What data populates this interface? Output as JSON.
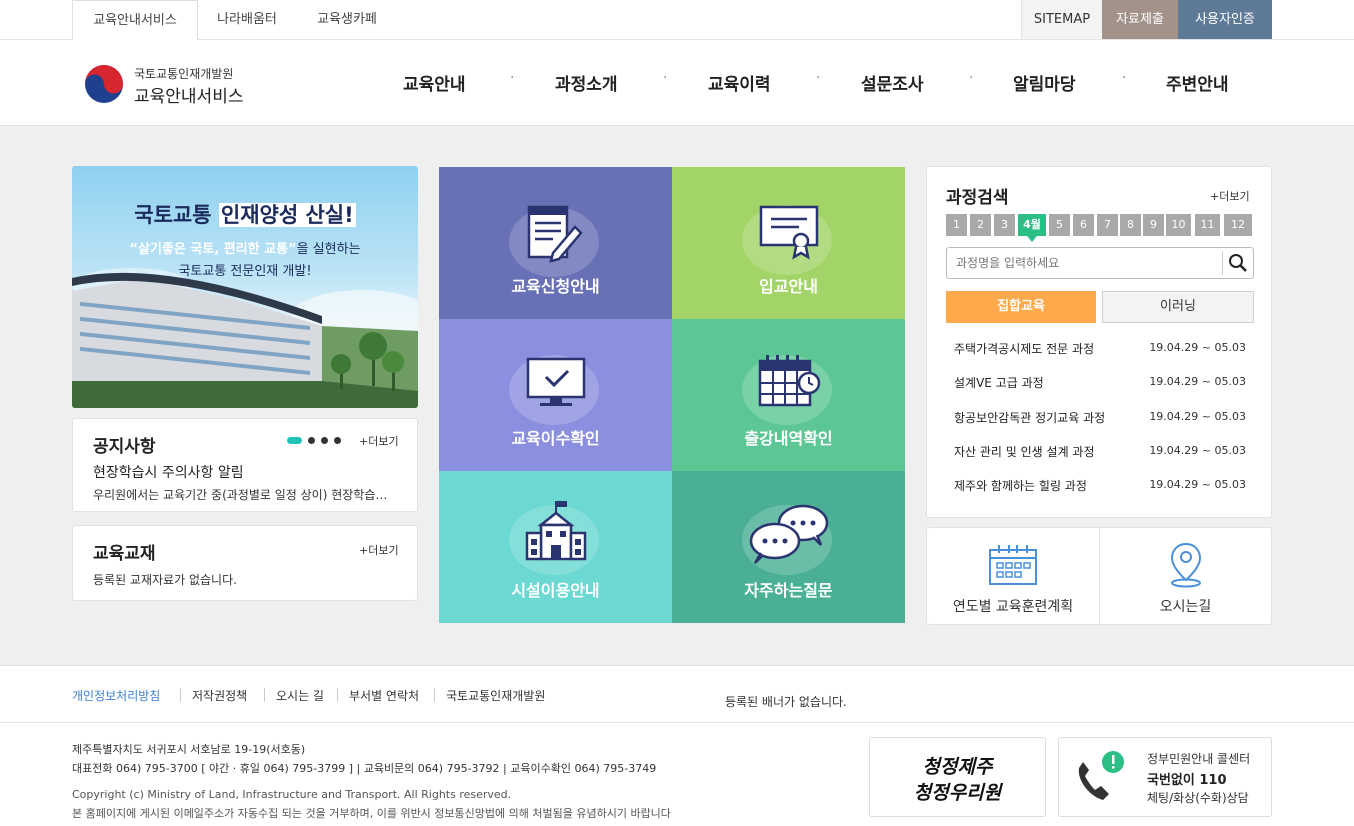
{
  "topbar": {
    "tabs": [
      "교육안내서비스",
      "나라배움터",
      "교육생카페"
    ],
    "sitemap": "SITEMAP",
    "submit": "자료제출",
    "auth": "사용자인증"
  },
  "logo": {
    "org": "국토교통인재개발원",
    "service": "교육안내서비스"
  },
  "gnb": [
    "교육안내",
    "과정소개",
    "교육이력",
    "설문조사",
    "알림마당",
    "주변안내"
  ],
  "banner": {
    "title_a": "국토교통",
    "title_b": "인재양성 산실!",
    "line1_quote": "“살기좋은 국토, 편리한 교통”",
    "line1_rest": "을 실현하는",
    "line2": "국토교통 전문인재 개발!"
  },
  "notice": {
    "title": "공지사항",
    "more": "+더보기",
    "item_title": "현장학습시 주의사항 알림",
    "item_desc": "우리원에서는 교육기간 중(과정별로 일정 상이) 현장학습…"
  },
  "textbook": {
    "title": "교육교재",
    "more": "+더보기",
    "empty": "등록된 교재자료가 없습니다."
  },
  "tiles": [
    "교육신청안내",
    "입교안내",
    "교육이수확인",
    "출강내역확인",
    "시설이용안내",
    "자주하는질문"
  ],
  "course_search": {
    "title": "과정검색",
    "more": "+더보기",
    "months": [
      "1",
      "2",
      "3",
      "4월",
      "5",
      "6",
      "7",
      "8",
      "9",
      "10",
      "11",
      "12"
    ],
    "placeholder": "과정명을 입력하세요",
    "tab_group": "집합교육",
    "tab_elearn": "이러닝",
    "courses": [
      {
        "name": "주택가격공시제도 전문 과정",
        "date": "19.04.29 ~ 05.03"
      },
      {
        "name": "설계VE 고급 과정",
        "date": "19.04.29 ~ 05.03"
      },
      {
        "name": "항공보안감독관 정기교육 과정",
        "date": "19.04.29 ~ 05.03"
      },
      {
        "name": "자산 관리 및 인생 설계 과정",
        "date": "19.04.29 ~ 05.03"
      },
      {
        "name": "제주와 함께하는 힐링 과정",
        "date": "19.04.29 ~ 05.03"
      }
    ]
  },
  "quick": {
    "plan": "연도별 교육훈련계획",
    "directions": "오시는길"
  },
  "footer": {
    "links": [
      "개인정보처리방침",
      "저작권정책",
      "오시는 길",
      "부서별 연락처",
      "국토교통인재개발원"
    ],
    "banner_empty": "등록된 배너가 없습니다.",
    "address": "제주특별자치도 서귀포시 서호남로 19-19(서호동)",
    "phones": "대표전화 064) 795-3700 [ 야간 · 휴일 064) 795-3799 ]  |  교육비문의 064) 795-3792  |  교육이수확인 064) 795-3749",
    "copyright": "Copyright (c) Ministry of Land, Infrastructure and Transport. All Rights reserved.",
    "notice": "본 홈페이지에 게시된 이메일주소가 자동수집 되는 것을 거부하며, 이를 위반시 정보통신망법에 의해 처벌됨을 유념하시기 바랍니다",
    "slogan1": "청정제주",
    "slogan2": "청정우리원",
    "call_line1": "정부민원안내 콜센터",
    "call_line2": "국번없이 110",
    "call_line3": "체팅/화상(수화)상담"
  },
  "colors": {
    "accent_green": "#2bbf86",
    "orange": "#ffa94d",
    "auth_bg": "#5f7a96",
    "submit_bg": "#a3928a"
  }
}
